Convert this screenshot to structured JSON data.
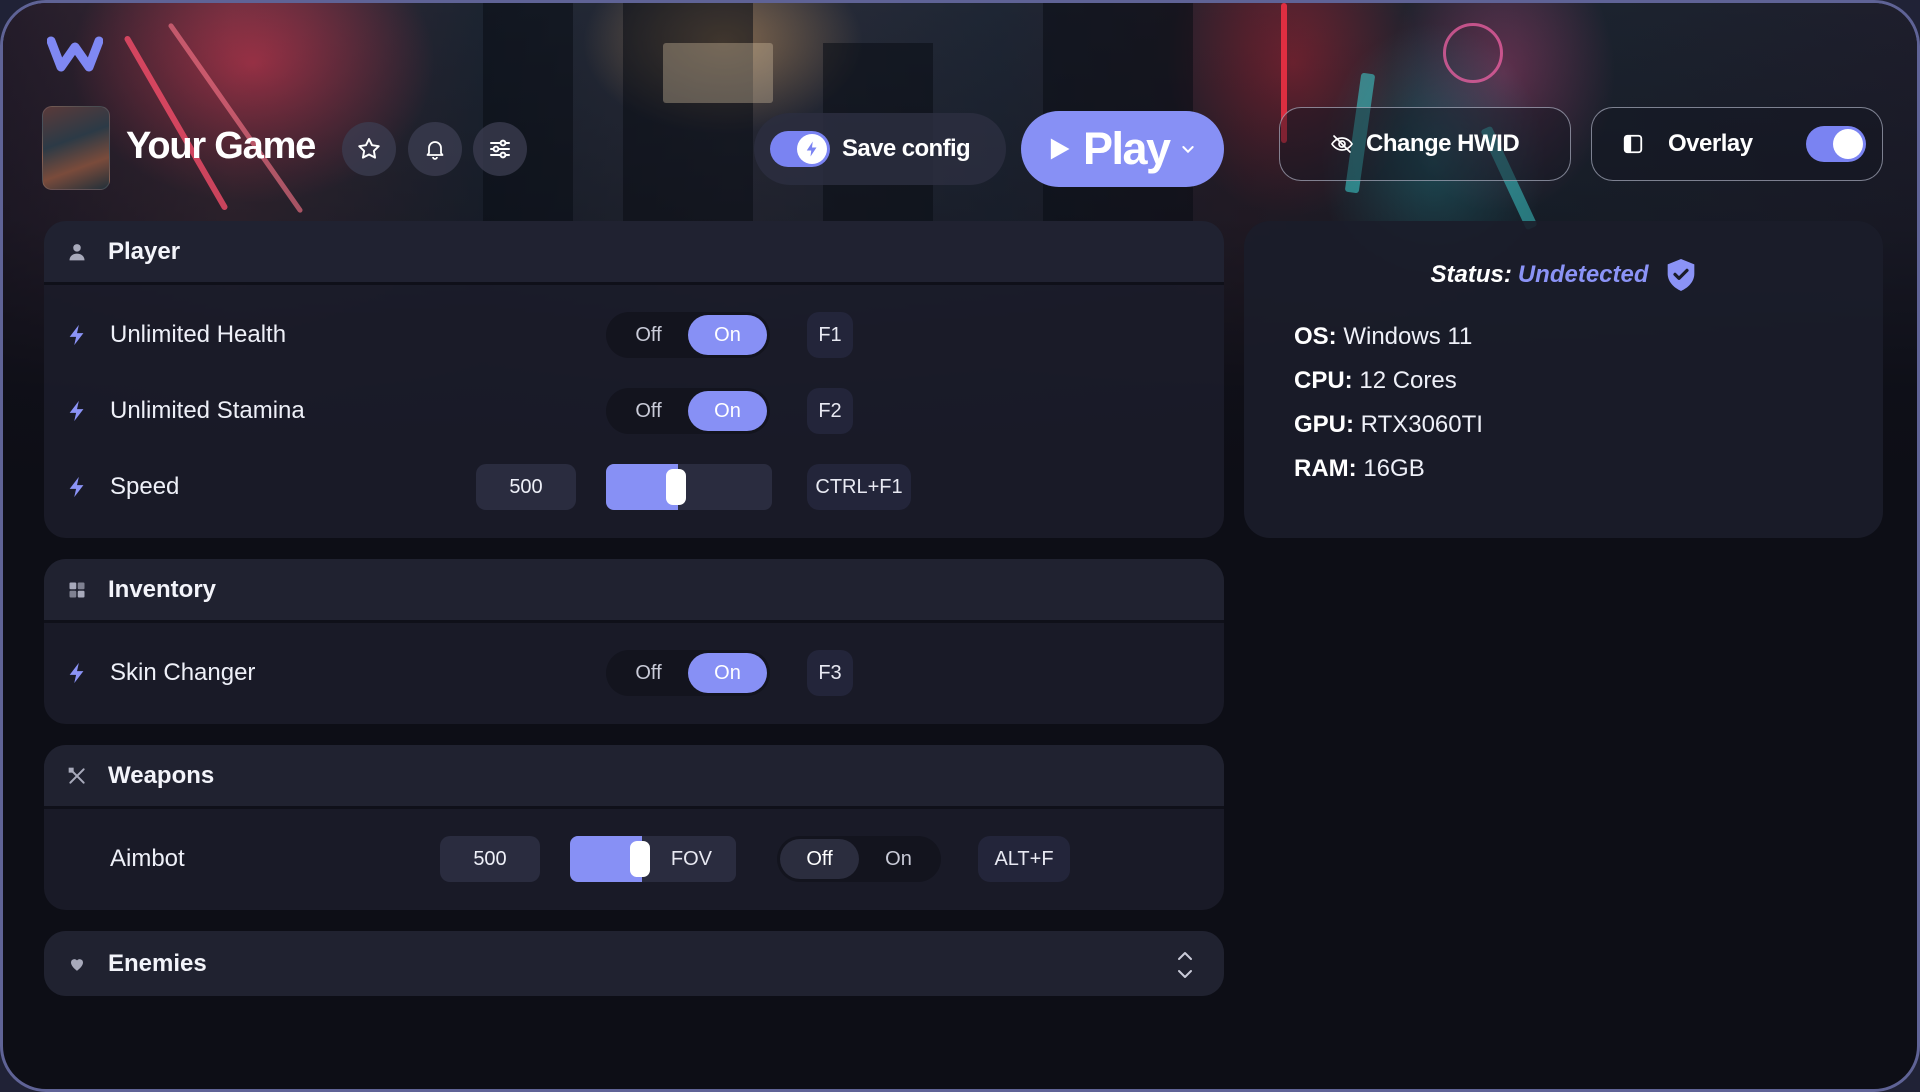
{
  "header": {
    "logo_icon": "w-logo-icon",
    "game_title": "Your Game",
    "save_config_label": "Save config",
    "play_label": "Play",
    "change_hwid_label": "Change HWID",
    "overlay_label": "Overlay",
    "overlay_enabled": true,
    "save_config_enabled": true
  },
  "sections": {
    "player": {
      "title": "Player",
      "icon": "user-icon",
      "rows": [
        {
          "label": "Unlimited Health",
          "off": "Off",
          "on": "On",
          "state": "On",
          "key": "F1"
        },
        {
          "label": "Unlimited Stamina",
          "off": "Off",
          "on": "On",
          "state": "On",
          "key": "F2"
        },
        {
          "label": "Speed",
          "value": "500",
          "slider_fraction": 0.43,
          "key": "CTRL+F1"
        }
      ]
    },
    "inventory": {
      "title": "Inventory",
      "icon": "grid-icon",
      "rows": [
        {
          "label": "Skin Changer",
          "off": "Off",
          "on": "On",
          "state": "On",
          "key": "F3"
        }
      ]
    },
    "weapons": {
      "title": "Weapons",
      "icon": "crossed-swords-icon",
      "rows": [
        {
          "label": "Aimbot",
          "value": "500",
          "slider_label": "FOV",
          "slider_fraction": 0.43,
          "off": "Off",
          "on": "On",
          "state": "Off",
          "key": "ALT+F"
        }
      ]
    },
    "enemies": {
      "title": "Enemies",
      "icon": "heart-icon",
      "expander_icon": "chevron-up-down-icon"
    }
  },
  "status": {
    "label": "Status:",
    "value": "Undetected",
    "specs": [
      {
        "key": "OS:",
        "value": "Windows 11"
      },
      {
        "key": "CPU:",
        "value": "12 Cores"
      },
      {
        "key": "GPU:",
        "value": "RTX3060TI"
      },
      {
        "key": "RAM:",
        "value": "16GB"
      }
    ]
  },
  "colors": {
    "accent": "#8790f5",
    "panel": "#1b1d2a",
    "background": "#0d0e16"
  }
}
